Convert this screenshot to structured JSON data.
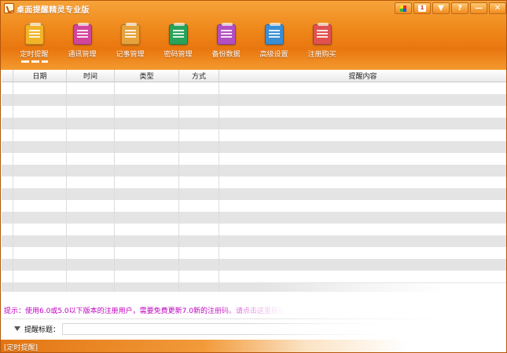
{
  "window": {
    "title": "桌面提醒精灵专业版",
    "buttons": [
      {
        "name": "skin-button",
        "label": ""
      },
      {
        "name": "badge-button",
        "label": "1"
      },
      {
        "name": "menu-button",
        "label": "▼"
      },
      {
        "name": "help-button",
        "label": "?"
      },
      {
        "name": "minimize-button",
        "label": "—"
      },
      {
        "name": "close-button",
        "label": "✕"
      }
    ]
  },
  "toolbar": {
    "items": [
      {
        "label": "定时提醒",
        "icon": "alarm-clock-icon",
        "color": "#f2b329"
      },
      {
        "label": "通讯管理",
        "icon": "address-book-icon",
        "color": "#d2459c"
      },
      {
        "label": "记事管理",
        "icon": "notepad-icon",
        "color": "#e7a23b"
      },
      {
        "label": "密码管理",
        "icon": "password-book-icon",
        "color": "#29a35b"
      },
      {
        "label": "备份数据",
        "icon": "backup-disk-icon",
        "color": "#b24fc2"
      },
      {
        "label": "高级设置",
        "icon": "settings-gear-icon",
        "color": "#3a8ed4"
      },
      {
        "label": "注册购买",
        "icon": "purchase-bag-icon",
        "color": "#e0524f"
      }
    ]
  },
  "table": {
    "columns": [
      "",
      "日期",
      "时间",
      "类型",
      "方式",
      "提醒内容"
    ],
    "row_count": 18
  },
  "tip": {
    "label": "提示：",
    "text": "使用6.0或5.0以下版本的注册用户，需要免费更新7.0新的注册码。请点击这里获取"
  },
  "remind": {
    "label": "提醒标题："
  },
  "status": {
    "text": "[定时提醒]"
  },
  "colors": {
    "accent": "#f08c1e",
    "tip": "#c100c1"
  }
}
